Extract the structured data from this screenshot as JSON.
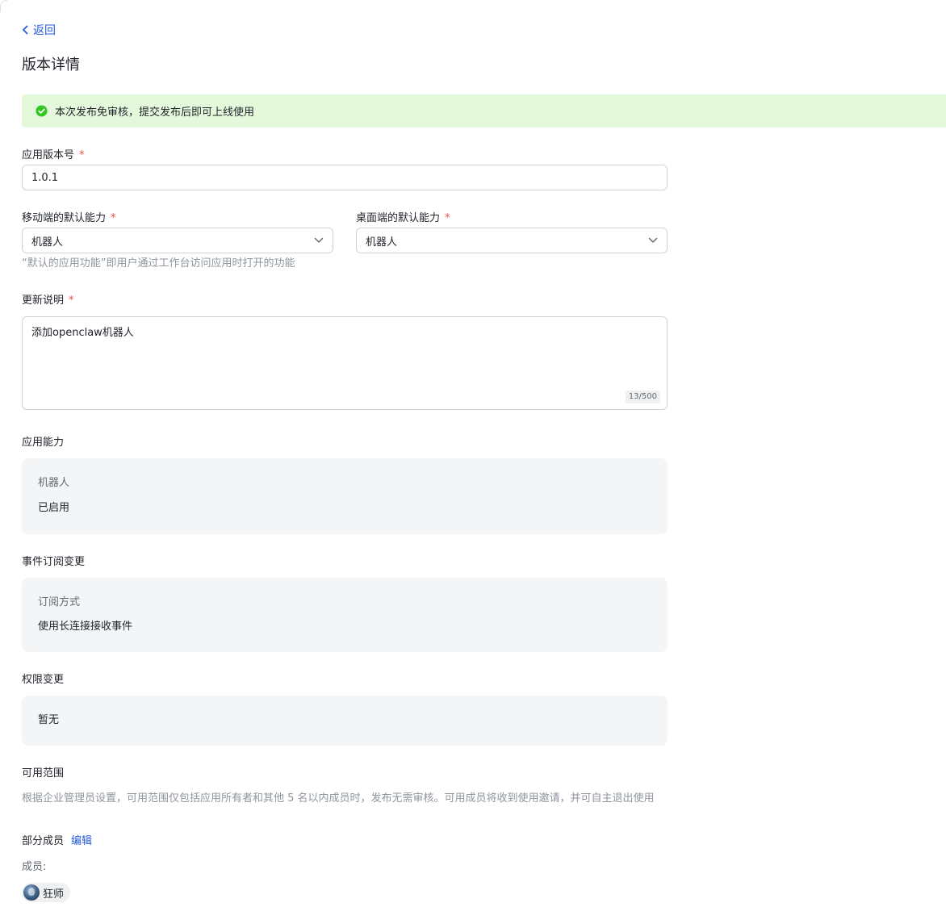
{
  "nav": {
    "back_label": "返回"
  },
  "page": {
    "title": "版本详情"
  },
  "notice": {
    "text": "本次发布免审核，提交发布后即可上线使用",
    "color": "#e4f8dc",
    "icon": "check-circle-icon"
  },
  "form": {
    "required_mark": "*",
    "version": {
      "label": "应用版本号",
      "value": "1.0.1"
    },
    "mobile_default": {
      "label": "移动端的默认能力",
      "value": "机器人"
    },
    "desktop_default": {
      "label": "桌面端的默认能力",
      "value": "机器人"
    },
    "default_hint": "“默认的应用功能”即用户通过工作台访问应用时打开的功能",
    "release_notes": {
      "label": "更新说明",
      "value": "添加openclaw机器人",
      "counter": "13/500"
    }
  },
  "capabilities": {
    "title": "应用能力",
    "key": "机器人",
    "value": "已启用"
  },
  "events": {
    "title": "事件订阅变更",
    "key": "订阅方式",
    "value": "使用长连接接收事件"
  },
  "permissions": {
    "title": "权限变更",
    "value": "暂无"
  },
  "availability": {
    "title": "可用范围",
    "description": "根据企业管理员设置，可用范围仅包括应用所有者和其他 5 名以内成员时，发布无需审核。可用成员将收到使用邀请，并可自主退出使用",
    "scope_label": "部分成员",
    "edit_label": "编辑",
    "members_label": "成员:",
    "members": [
      "狂师"
    ]
  },
  "colors": {
    "link": "#245bdb",
    "required": "#f54a45",
    "success": "#34c724"
  }
}
